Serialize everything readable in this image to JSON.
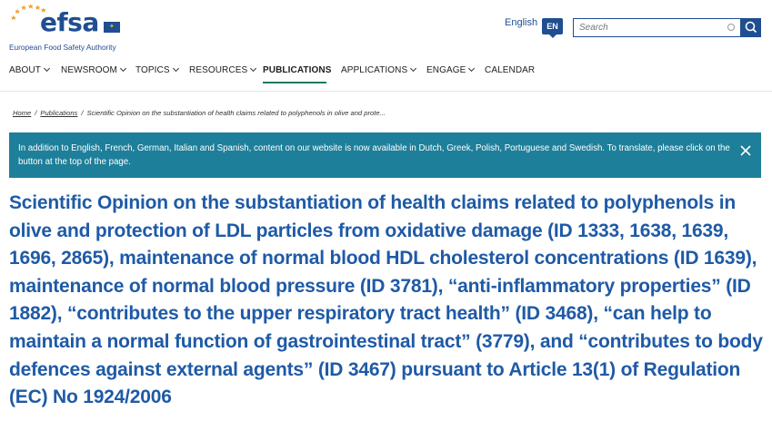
{
  "header": {
    "logo_word": "efsa",
    "logo_subtitle": "European Food Safety Authority",
    "language_label": "English",
    "language_code": "EN",
    "search": {
      "placeholder": "Search",
      "value": ""
    }
  },
  "nav": {
    "items": [
      {
        "label": "ABOUT",
        "has_menu": true
      },
      {
        "label": "NEWSROOM",
        "has_menu": true
      },
      {
        "label": "TOPICS",
        "has_menu": true
      },
      {
        "label": "RESOURCES",
        "has_menu": true
      },
      {
        "label": "PUBLICATIONS",
        "has_menu": false,
        "active": true
      },
      {
        "label": "APPLICATIONS",
        "has_menu": true
      },
      {
        "label": "ENGAGE",
        "has_menu": true
      },
      {
        "label": "CALENDAR",
        "has_menu": false
      }
    ]
  },
  "breadcrumb": {
    "home": "Home",
    "publications": "Publications",
    "current": "Scientific Opinion on the substantiation of health claims related to polyphenols in olive and prote..."
  },
  "banner": {
    "text": "In addition to English, French, German, Italian and Spanish, content on our website is now available in Dutch, Greek, Polish, Portuguese and Swedish. To translate, please click on the button at the top of the page."
  },
  "page_title": "Scientific Opinion on the substantiation of health claims related to polyphenols in olive and protection of LDL particles from oxidative damage (ID 1333, 1638, 1639, 1696, 2865), maintenance of normal blood HDL cholesterol concentrations (ID 1639), maintenance of normal blood pressure (ID 3781), “anti-inflammatory properties” (ID 1882), “contributes to the upper respiratory tract health” (ID 3468), “can help to maintain a normal function of gastrointestinal tract” (3779), and “contributes to body defences against external agents” (ID 3467) pursuant to Article 13(1) of Regulation (EC) No 1924/2006",
  "colors": {
    "brand_blue": "#1f4e91",
    "title_blue": "#1f5aa6",
    "banner_teal": "#1e7f9a",
    "active_underline": "#1f7a5c",
    "logo_stars": "#f39c1f"
  }
}
